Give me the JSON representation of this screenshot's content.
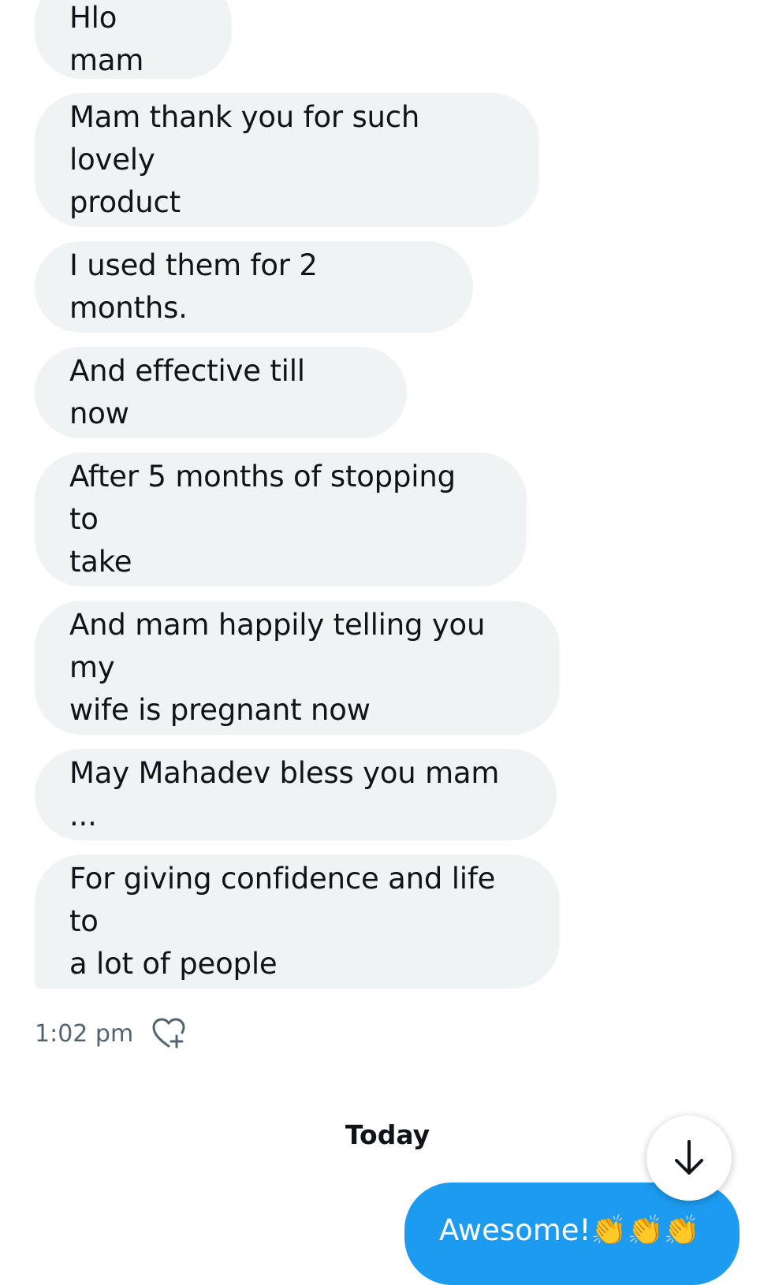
{
  "conversation": {
    "received_messages": [
      {
        "text": "Hlo mam"
      },
      {
        "text": "Mam thank you for such lovely\nproduct"
      },
      {
        "text": "I used them for 2 months."
      },
      {
        "text": "And effective till now"
      },
      {
        "text": "After 5 months of stopping to\ntake"
      },
      {
        "text": "And mam happily telling you my\nwife is pregnant now"
      },
      {
        "text": "May Mahadev bless you mam ..."
      },
      {
        "text": "For giving confidence and life to\na lot of people"
      }
    ],
    "timestamp": "1:02 pm",
    "day_divider": "Today",
    "sent_message": {
      "text": "Awesome!",
      "emoji": "👏👏👏"
    }
  },
  "icons": {
    "react": "heart-plus-icon",
    "scroll_down": "arrow-down-icon"
  },
  "colors": {
    "received_bubble": "#eff3f4",
    "sent_bubble": "#1d9bf0",
    "timestamp_text": "#536471",
    "primary_text": "#0f1419"
  }
}
